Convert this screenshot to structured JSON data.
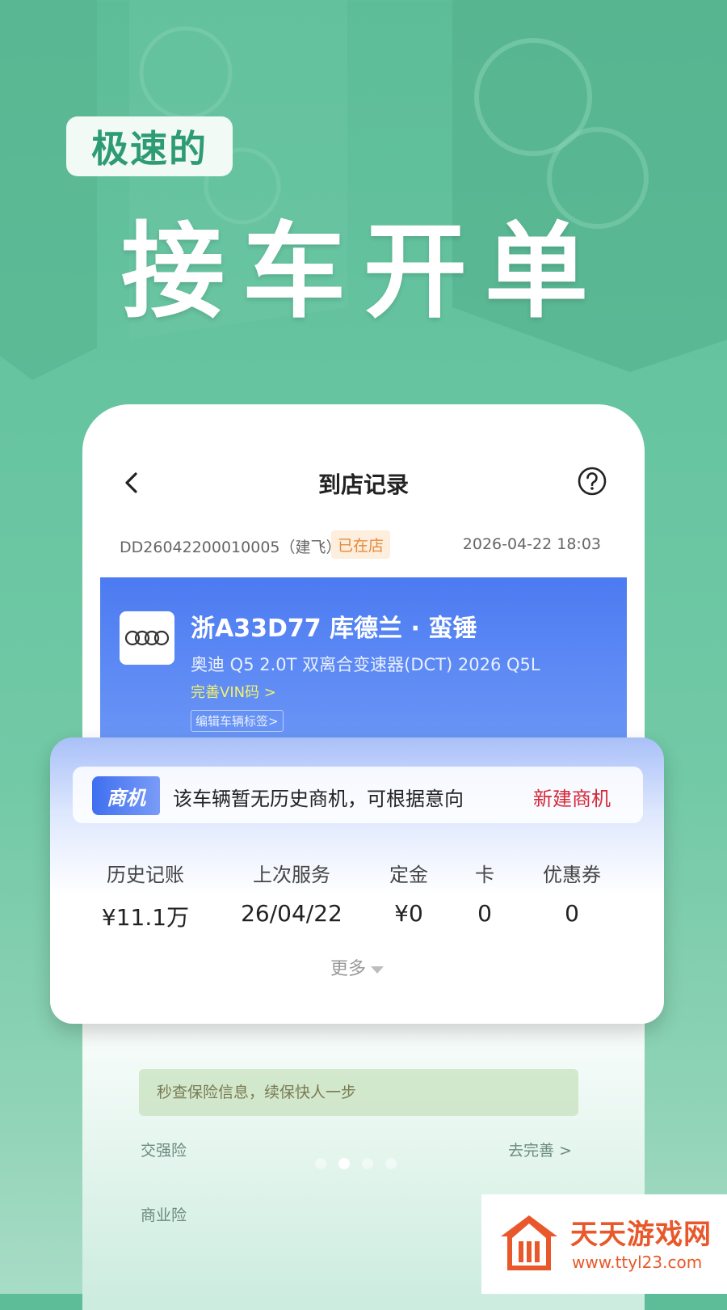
{
  "promo": {
    "tag": "极速的",
    "headline": "接车开单"
  },
  "app": {
    "nav": {
      "title": "到店记录"
    },
    "order": {
      "number": "DD26042200010005（建飞）",
      "status": "已在店",
      "time": "2026-04-22 18:03"
    },
    "vehicle": {
      "plate_and_owner": "浙A33D77 库德兰 · 蛮锤",
      "model": "奥迪 Q5 2.0T 双离合变速器(DCT) 2026 Q5L",
      "vin_link": "完善VIN码 >",
      "edit_tags": "编辑车辆标签>"
    },
    "business": {
      "badge": "商机",
      "message": "该车辆暂无历史商机，可根据意向",
      "new_button": "新建商机",
      "stats": [
        {
          "label": "历史记账",
          "value": "¥11.1万"
        },
        {
          "label": "上次服务",
          "value": "26/04/22"
        },
        {
          "label": "定金",
          "value": "¥0"
        },
        {
          "label": "卡",
          "value": "0"
        },
        {
          "label": "优惠券",
          "value": "0"
        }
      ],
      "more": "更多"
    },
    "insurance": {
      "banner": "秒查保险信息，续保快人一步",
      "compulsory": "交强险",
      "compulsory_action": "去完善 >",
      "commercial": "商业险"
    },
    "pager": {
      "total": 4,
      "active_index": 1
    }
  },
  "watermark": {
    "title": "天天游戏网",
    "url": "www.ttyl23.com"
  },
  "colors": {
    "bg_green": "#66c4a0",
    "card_blue": "#4c7bf2",
    "accent_red": "#d6293a",
    "status_orange": "#e8893b",
    "watermark_orange": "#e8582a"
  }
}
